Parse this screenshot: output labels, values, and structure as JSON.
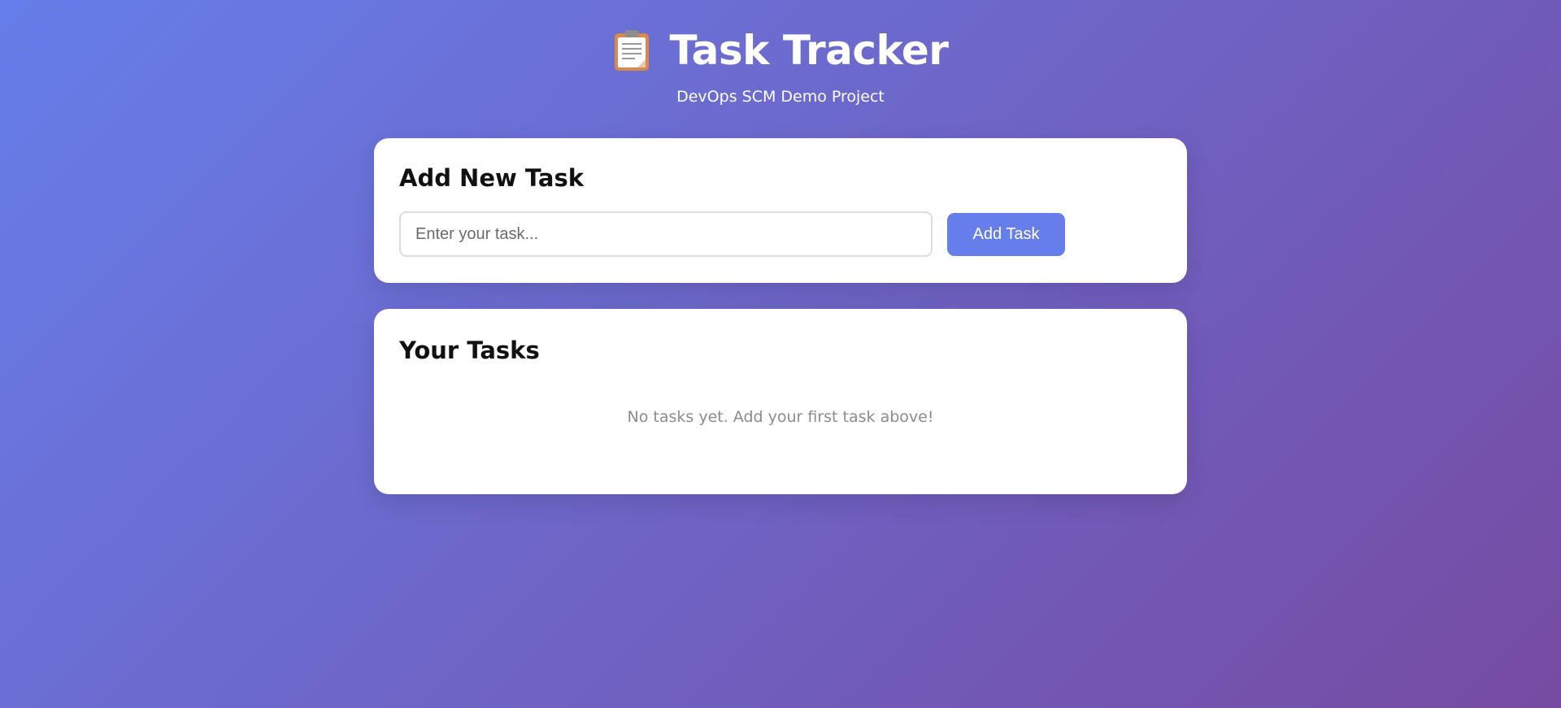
{
  "header": {
    "title": "Task Tracker",
    "subtitle": "DevOps SCM Demo Project",
    "icon": "clipboard-icon"
  },
  "add_card": {
    "heading": "Add New Task",
    "input_placeholder": "Enter your task...",
    "input_value": "",
    "button_label": "Add Task"
  },
  "list_card": {
    "heading": "Your Tasks",
    "empty_message": "No tasks yet. Add your first task above!"
  },
  "colors": {
    "gradient_start": "#667eea",
    "gradient_end": "#764ba2",
    "accent": "#667eea"
  }
}
